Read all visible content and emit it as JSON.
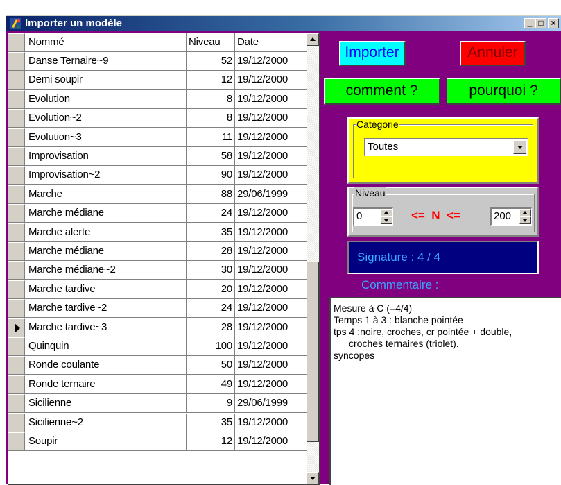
{
  "window": {
    "title": "Importer un modèle",
    "controls": {
      "minimize": "_",
      "maximize": "□",
      "close": "×"
    }
  },
  "grid": {
    "columns": [
      "Nommé",
      "Niveau",
      "Date"
    ],
    "rows": [
      {
        "name": "Danse Ternaire~9",
        "niveau": "52",
        "date": "19/12/2000"
      },
      {
        "name": "Demi soupir",
        "niveau": "12",
        "date": "19/12/2000"
      },
      {
        "name": "Evolution",
        "niveau": "8",
        "date": "19/12/2000"
      },
      {
        "name": "Evolution~2",
        "niveau": "8",
        "date": "19/12/2000"
      },
      {
        "name": "Evolution~3",
        "niveau": "11",
        "date": "19/12/2000"
      },
      {
        "name": "Improvisation",
        "niveau": "58",
        "date": "19/12/2000"
      },
      {
        "name": "Improvisation~2",
        "niveau": "90",
        "date": "19/12/2000"
      },
      {
        "name": "Marche",
        "niveau": "88",
        "date": "29/06/1999"
      },
      {
        "name": "Marche  médiane",
        "niveau": "24",
        "date": "19/12/2000"
      },
      {
        "name": "Marche alerte",
        "niveau": "35",
        "date": "19/12/2000"
      },
      {
        "name": "Marche médiane",
        "niveau": "28",
        "date": "19/12/2000"
      },
      {
        "name": "Marche médiane~2",
        "niveau": "30",
        "date": "19/12/2000"
      },
      {
        "name": "Marche tardive",
        "niveau": "20",
        "date": "19/12/2000"
      },
      {
        "name": "Marche tardive~2",
        "niveau": "24",
        "date": "19/12/2000"
      },
      {
        "name": "Marche tardive~3",
        "niveau": "28",
        "date": "19/12/2000",
        "current": true
      },
      {
        "name": "Quinquin",
        "niveau": "100",
        "date": "19/12/2000"
      },
      {
        "name": "Ronde coulante",
        "niveau": "50",
        "date": "19/12/2000"
      },
      {
        "name": "Ronde ternaire",
        "niveau": "49",
        "date": "19/12/2000"
      },
      {
        "name": "Sicilienne",
        "niveau": "9",
        "date": "29/06/1999"
      },
      {
        "name": "Sicilienne~2",
        "niveau": "35",
        "date": "19/12/2000"
      },
      {
        "name": "Soupir",
        "niveau": "12",
        "date": "19/12/2000"
      }
    ]
  },
  "buttons": {
    "importer": "Importer",
    "annuler": "Annuler",
    "comment": "comment ?",
    "pourquoi": "pourquoi  ?"
  },
  "categorie": {
    "legend": "Catégorie",
    "value": "Toutes"
  },
  "niveau": {
    "legend": "Niveau",
    "min": "0",
    "max": "200",
    "operator_label": "<=  N  <="
  },
  "signature": "Signature : 4 / 4",
  "commentaire": {
    "label": "Commentaire :",
    "lines": [
      "Mesure à C (=4/4)",
      "Temps 1 à 3 : blanche pointée",
      "tps 4 :noire, croches, cr pointée + double,",
      "croches ternaires (triolet).",
      "syncopes"
    ]
  },
  "colors": {
    "window_bg": "#800080",
    "importer_bg": "#00ffff",
    "importer_fg": "#0000ff",
    "annuler_bg": "#ff0000",
    "green_btn_bg": "#00ff00",
    "categorie_bg": "#ffff00",
    "signature_bg": "#000080",
    "signature_fg": "#3ba5ff"
  }
}
